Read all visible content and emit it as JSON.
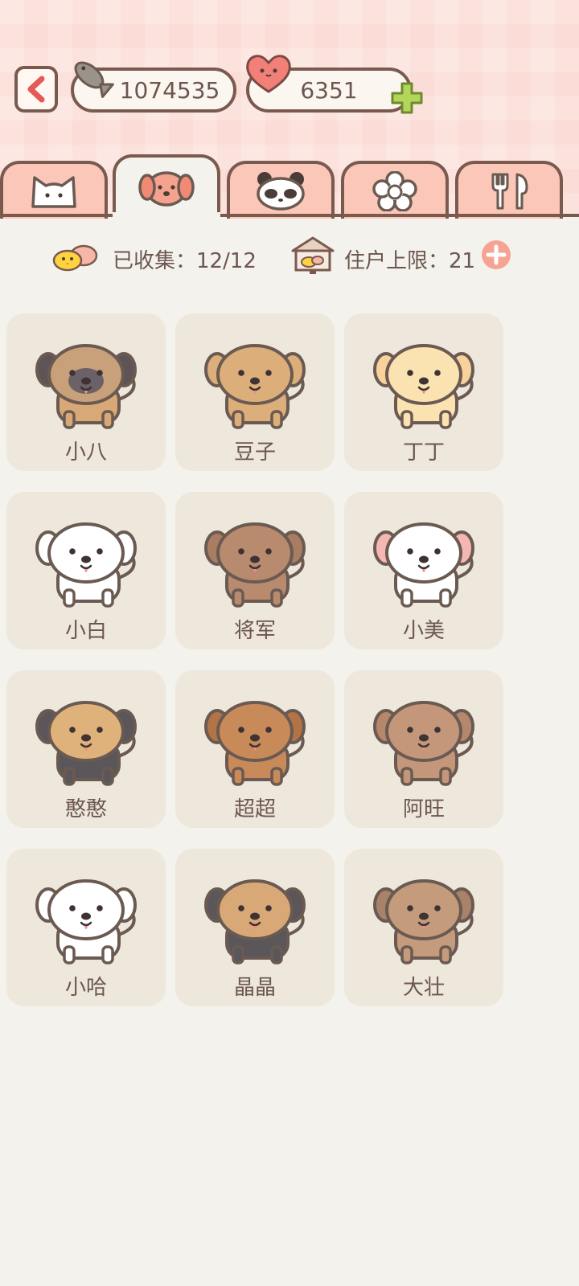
{
  "header": {
    "fish_count": "1074535",
    "heart_count": "6351"
  },
  "tabs": [
    {
      "name": "cat",
      "icon": "cat-face-icon",
      "active": false
    },
    {
      "name": "dog",
      "icon": "dog-face-icon",
      "active": true
    },
    {
      "name": "panda",
      "icon": "panda-face-icon",
      "active": false
    },
    {
      "name": "flower",
      "icon": "flower-icon",
      "active": false
    },
    {
      "name": "food",
      "icon": "fork-spoon-icon",
      "active": false
    }
  ],
  "stats": {
    "collected_label": "已收集：12/12",
    "residents_label": "住户上限：21"
  },
  "dogs": [
    {
      "name": "小八",
      "body": "#d9a877",
      "ear": "#5e5456",
      "face": "#c8a07a",
      "mask": true
    },
    {
      "name": "豆子",
      "body": "#dcae7a",
      "ear": "#dcae7a",
      "face": "#dcae7a",
      "mask": false
    },
    {
      "name": "丁丁",
      "body": "#fbe2b1",
      "ear": "#f8d29c",
      "face": "#fbe2b1",
      "mask": false
    },
    {
      "name": "小白",
      "body": "#ffffff",
      "ear": "#ffffff",
      "face": "#ffffff",
      "mask": false
    },
    {
      "name": "将军",
      "body": "#b88a6e",
      "ear": "#a97d62",
      "face": "#b88a6e",
      "mask": false
    },
    {
      "name": "小美",
      "body": "#ffffff",
      "ear": "#f6b7b2",
      "face": "#ffffff",
      "mask": false
    },
    {
      "name": "憨憨",
      "body": "#5b5659",
      "ear": "#5b5659",
      "face": "#e0b27b",
      "mask": false
    },
    {
      "name": "超超",
      "body": "#c98a59",
      "ear": "#b37445",
      "face": "#c98a59",
      "mask": false
    },
    {
      "name": "阿旺",
      "body": "#c5977a",
      "ear": "#b5876c",
      "face": "#c5977a",
      "mask": false
    },
    {
      "name": "小哈",
      "body": "#ffffff",
      "ear": "#ffffff",
      "face": "#ffffff",
      "mask": false
    },
    {
      "name": "晶晶",
      "body": "#5b5659",
      "ear": "#5b5659",
      "face": "#d9a877",
      "mask": false
    },
    {
      "name": "大壮",
      "body": "#c49c7c",
      "ear": "#a9826a",
      "face": "#c49c7c",
      "mask": false
    }
  ]
}
